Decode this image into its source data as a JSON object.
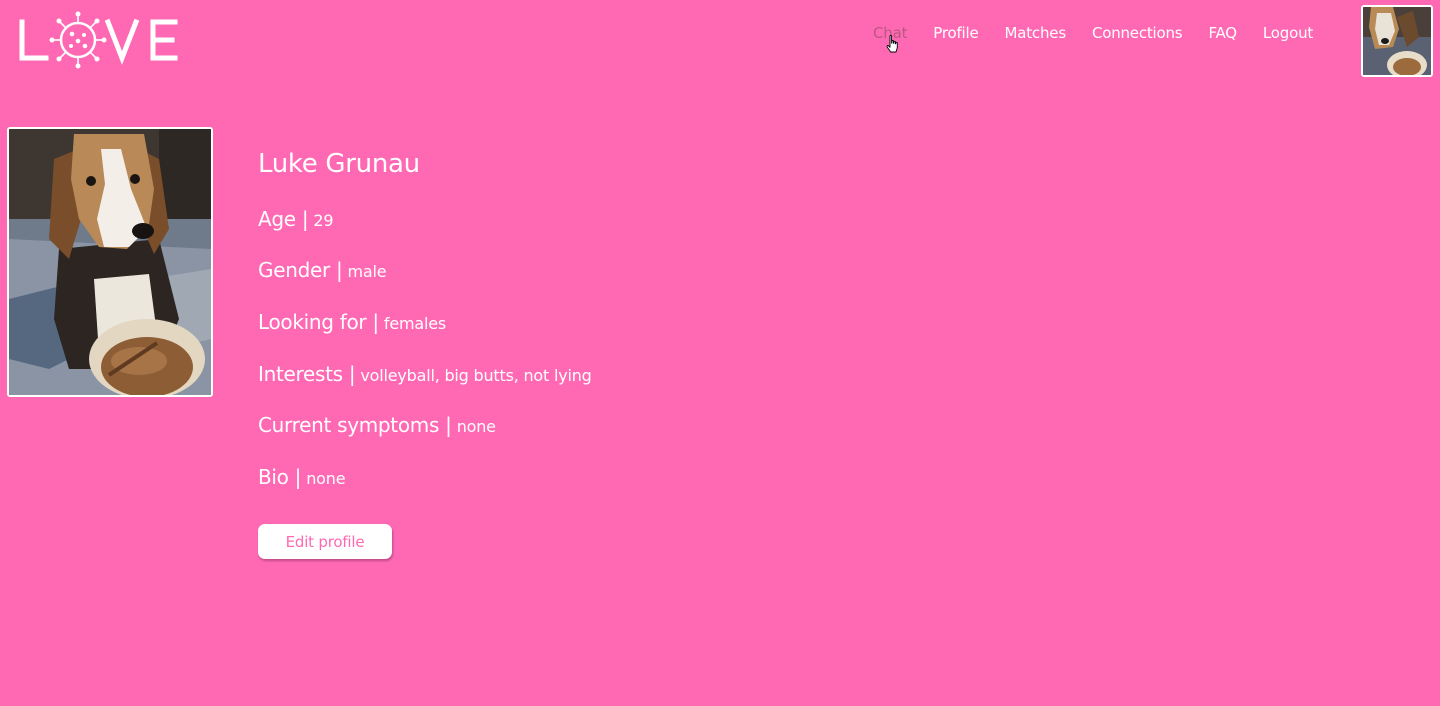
{
  "colors": {
    "background": "#ff69b4",
    "text": "#ffffff",
    "nav_hover": "#b8587f",
    "button_bg": "#ffffff",
    "button_text": "#ff69b4"
  },
  "header": {
    "logo_text": "LOVE",
    "nav": [
      {
        "label": "Chat",
        "hover": true
      },
      {
        "label": "Profile"
      },
      {
        "label": "Matches"
      },
      {
        "label": "Connections"
      },
      {
        "label": "FAQ"
      },
      {
        "label": "Logout"
      }
    ],
    "avatar_icon": "user-avatar-dog-photo"
  },
  "profile": {
    "photo_icon": "dog-photo",
    "name": "Luke Grunau",
    "fields": [
      {
        "label": "Age |",
        "value": "29"
      },
      {
        "label": "Gender |",
        "value": "male"
      },
      {
        "label": "Looking for |",
        "value": "females"
      },
      {
        "label": "Interests |",
        "value": "volleyball, big butts, not lying"
      },
      {
        "label": "Current symptoms |",
        "value": "none"
      },
      {
        "label": "Bio |",
        "value": "none"
      }
    ],
    "edit_button": "Edit profile"
  }
}
